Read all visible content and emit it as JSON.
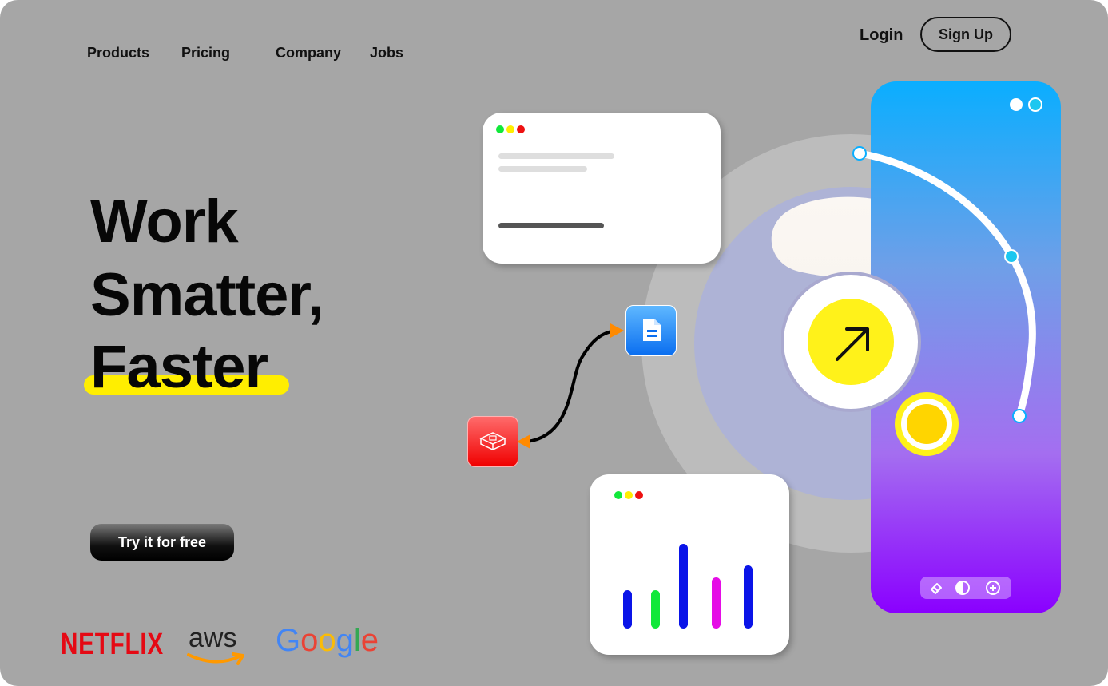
{
  "nav": {
    "products": "Products",
    "pricing": "Pricing",
    "company": "Company",
    "jobs": "Jobs",
    "login": "Login",
    "signup": "Sign Up"
  },
  "hero": {
    "line1": "Work",
    "line2": "Smatter,",
    "line3": "Faster",
    "cta": "Try it for free"
  },
  "logos": {
    "netflix": "NETFLIX",
    "aws": "aws",
    "google": "Google"
  },
  "colors": {
    "page_bg": "#a6a6a6",
    "accent_yellow": "#ffee00",
    "bar_colors": [
      "#0a14e8",
      "#11e83a",
      "#0a14e8",
      "#e50ce6",
      "#0a14e8"
    ]
  },
  "chart_card": {
    "bar_values": [
      45,
      45,
      100,
      60,
      75
    ]
  },
  "icons": {
    "doc": "document-icon",
    "box": "package-icon",
    "eraser": "eraser-icon",
    "contrast": "contrast-icon",
    "add": "add-circle-icon",
    "arrow": "arrow-up-right-icon"
  }
}
